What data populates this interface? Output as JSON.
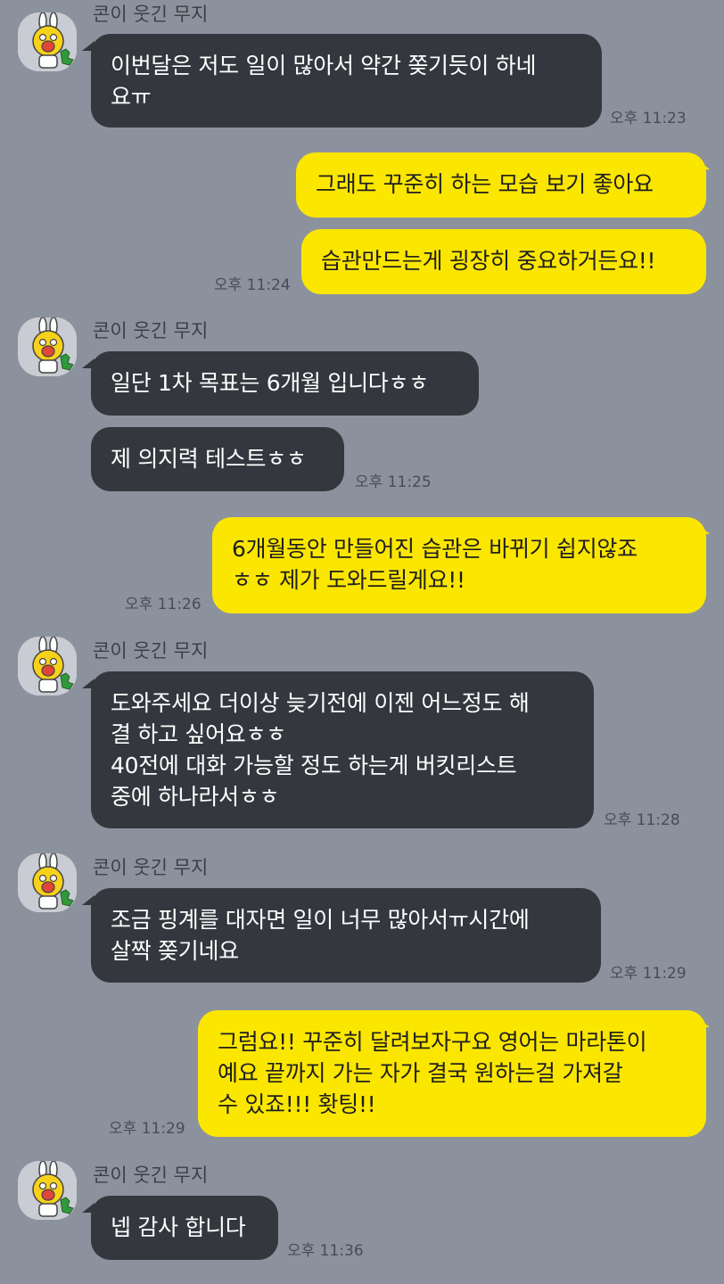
{
  "contact": {
    "name": "콘이 웃긴 무지",
    "avatar_icon": "muzi-character-icon"
  },
  "colors": {
    "background": "#8c929d",
    "incoming_bubble": "#34373d",
    "outgoing_bubble": "#fbe600"
  },
  "messages": [
    {
      "sender": "contact",
      "text": "이번달은 저도 일이 많아서 약간 쫒기듯이 하네\n요ㅠ",
      "time": "오후 11:23"
    },
    {
      "sender": "me",
      "text": "그래도 꾸준히 하는 모습 보기 좋아요"
    },
    {
      "sender": "me",
      "text": "습관만드는게 굉장히 중요하거든요!!",
      "time": "오후 11:24"
    },
    {
      "sender": "contact",
      "text": "일단 1차 목표는 6개월 입니다ㅎㅎ"
    },
    {
      "sender": "contact",
      "text": "제 의지력 테스트ㅎㅎ",
      "time": "오후 11:25"
    },
    {
      "sender": "me",
      "text": "6개월동안 만들어진 습관은 바뀌기 쉽지않죠\nㅎㅎ 제가 도와드릴게요!!",
      "time": "오후 11:26"
    },
    {
      "sender": "contact",
      "text": "도와주세요 더이상 늦기전에 이젠 어느정도 해\n결 하고 싶어요ㅎㅎ\n40전에 대화 가능할 정도 하는게 버킷리스트\n중에 하나라서ㅎㅎ",
      "time": "오후 11:28"
    },
    {
      "sender": "contact",
      "text": "조금 핑계를 대자면 일이 너무 많아서ㅠ시간에\n살짝 쫒기네요",
      "time": "오후 11:29"
    },
    {
      "sender": "me",
      "text": "그럼요!! 꾸준히 달려보자구요 영어는 마라톤이\n예요 끝까지 가는 자가 결국 원하는걸 가져갈\n수 있죠!!! 홧팅!!",
      "time": "오후 11:29"
    },
    {
      "sender": "contact",
      "text": "넵 감사 합니다",
      "time": "오후 11:36"
    }
  ]
}
